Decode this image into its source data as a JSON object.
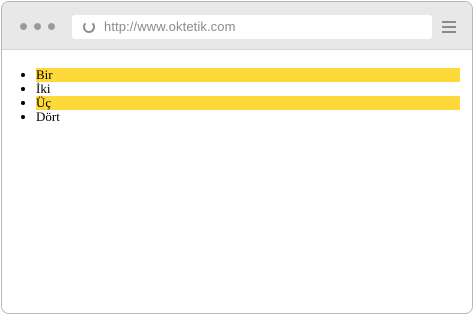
{
  "browser": {
    "url": "http://www.oktetik.com",
    "icons": {
      "window_controls": "traffic-light-dots",
      "reload": "reload-icon",
      "menu": "hamburger-menu-icon"
    }
  },
  "list": {
    "items": [
      {
        "label": "Bir",
        "highlighted": true
      },
      {
        "label": "İki",
        "highlighted": false
      },
      {
        "label": "Üç",
        "highlighted": true
      },
      {
        "label": "Dört",
        "highlighted": false
      }
    ],
    "highlight_color": "#fed93a"
  }
}
